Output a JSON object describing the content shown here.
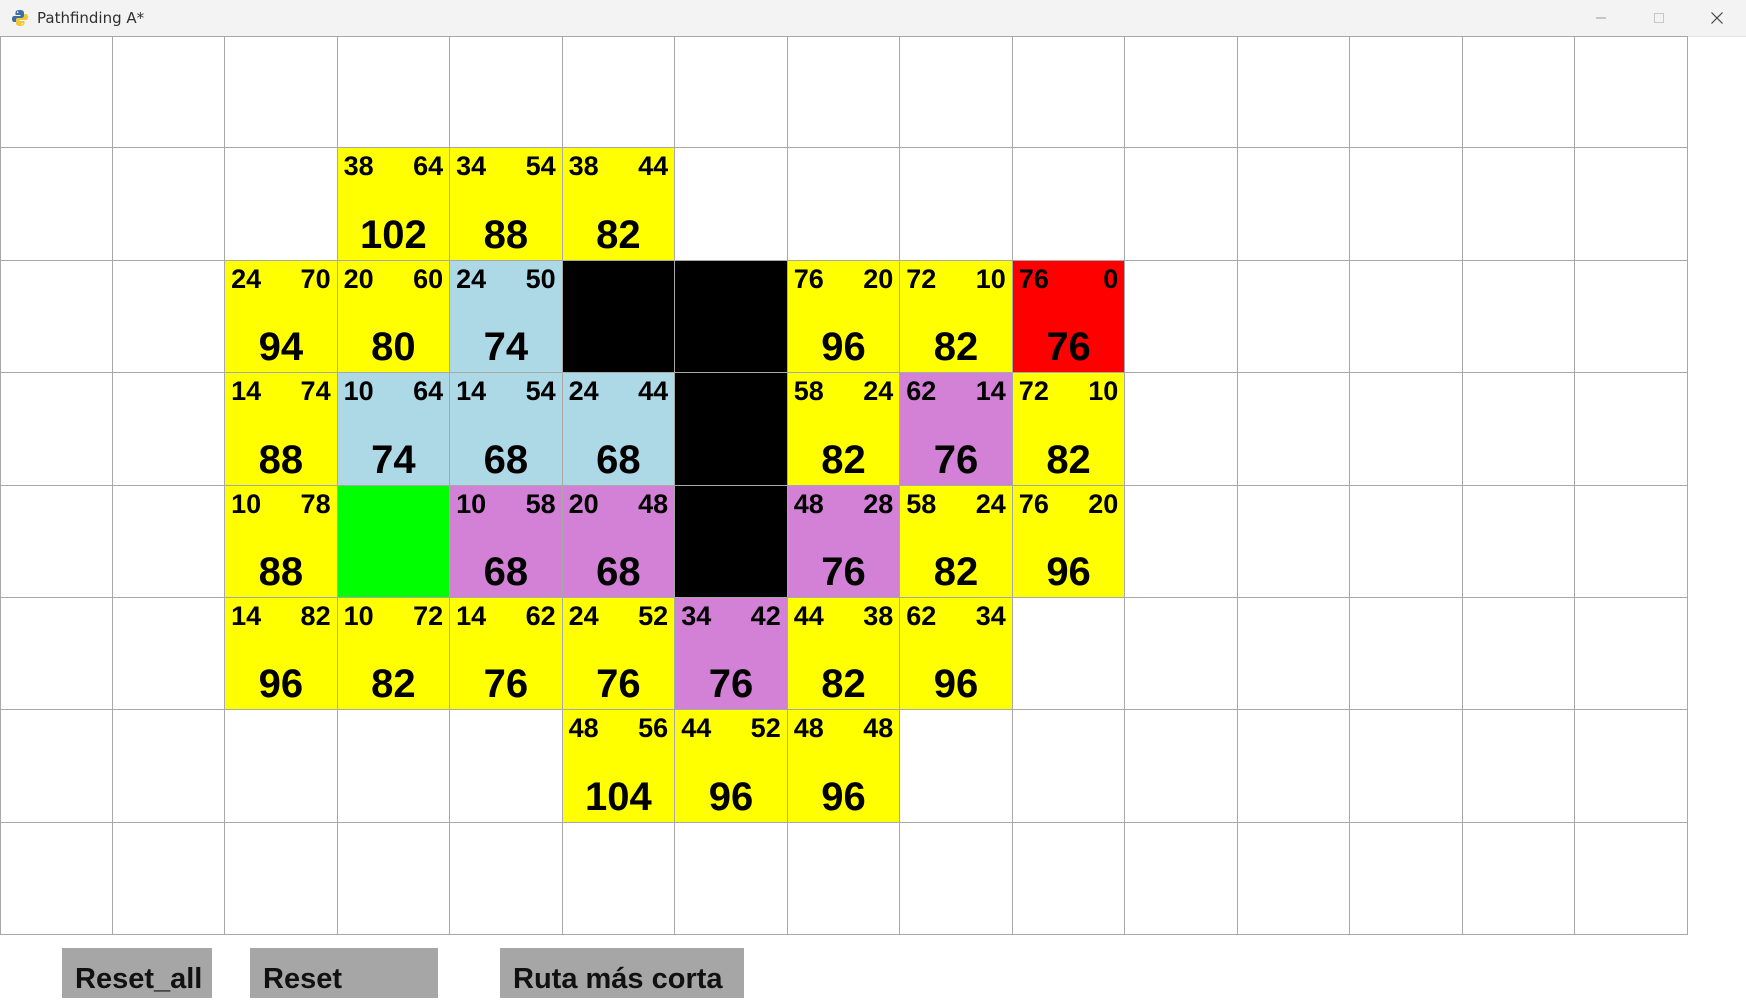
{
  "window": {
    "title": "Pathfinding A*",
    "icon": "python-icon",
    "controls": [
      "minimize-icon",
      "maximize-icon",
      "close-icon"
    ]
  },
  "grid": {
    "cols": 15,
    "rows": 8,
    "colors": {
      "empty": "#ffffff",
      "open": "#ffff00",
      "closed": "#add8e6",
      "path": "#d381d6",
      "barrier": "#000000",
      "start": "#00ff00",
      "end": "#ff0000"
    },
    "cells": [
      {
        "row": 1,
        "col": 3,
        "state": "open",
        "g": "38",
        "h": "64",
        "f": "102"
      },
      {
        "row": 1,
        "col": 4,
        "state": "open",
        "g": "34",
        "h": "54",
        "f": "88"
      },
      {
        "row": 1,
        "col": 5,
        "state": "open",
        "g": "38",
        "h": "44",
        "f": "82"
      },
      {
        "row": 2,
        "col": 2,
        "state": "open",
        "g": "24",
        "h": "70",
        "f": "94"
      },
      {
        "row": 2,
        "col": 3,
        "state": "open",
        "g": "20",
        "h": "60",
        "f": "80"
      },
      {
        "row": 2,
        "col": 4,
        "state": "closed",
        "g": "24",
        "h": "50",
        "f": "74"
      },
      {
        "row": 2,
        "col": 5,
        "state": "barrier"
      },
      {
        "row": 2,
        "col": 6,
        "state": "barrier"
      },
      {
        "row": 2,
        "col": 7,
        "state": "open",
        "g": "76",
        "h": "20",
        "f": "96"
      },
      {
        "row": 2,
        "col": 8,
        "state": "open",
        "g": "72",
        "h": "10",
        "f": "82"
      },
      {
        "row": 2,
        "col": 9,
        "state": "end",
        "g": "76",
        "h": "0",
        "f": "76"
      },
      {
        "row": 3,
        "col": 2,
        "state": "open",
        "g": "14",
        "h": "74",
        "f": "88"
      },
      {
        "row": 3,
        "col": 3,
        "state": "closed",
        "g": "10",
        "h": "64",
        "f": "74"
      },
      {
        "row": 3,
        "col": 4,
        "state": "closed",
        "g": "14",
        "h": "54",
        "f": "68"
      },
      {
        "row": 3,
        "col": 5,
        "state": "closed",
        "g": "24",
        "h": "44",
        "f": "68"
      },
      {
        "row": 3,
        "col": 6,
        "state": "barrier"
      },
      {
        "row": 3,
        "col": 7,
        "state": "open",
        "g": "58",
        "h": "24",
        "f": "82"
      },
      {
        "row": 3,
        "col": 8,
        "state": "path",
        "g": "62",
        "h": "14",
        "f": "76"
      },
      {
        "row": 3,
        "col": 9,
        "state": "open",
        "g": "72",
        "h": "10",
        "f": "82"
      },
      {
        "row": 4,
        "col": 2,
        "state": "open",
        "g": "10",
        "h": "78",
        "f": "88"
      },
      {
        "row": 4,
        "col": 3,
        "state": "start"
      },
      {
        "row": 4,
        "col": 4,
        "state": "path",
        "g": "10",
        "h": "58",
        "f": "68"
      },
      {
        "row": 4,
        "col": 5,
        "state": "path",
        "g": "20",
        "h": "48",
        "f": "68"
      },
      {
        "row": 4,
        "col": 6,
        "state": "barrier"
      },
      {
        "row": 4,
        "col": 7,
        "state": "path",
        "g": "48",
        "h": "28",
        "f": "76"
      },
      {
        "row": 4,
        "col": 8,
        "state": "open",
        "g": "58",
        "h": "24",
        "f": "82"
      },
      {
        "row": 4,
        "col": 9,
        "state": "open",
        "g": "76",
        "h": "20",
        "f": "96"
      },
      {
        "row": 5,
        "col": 2,
        "state": "open",
        "g": "14",
        "h": "82",
        "f": "96"
      },
      {
        "row": 5,
        "col": 3,
        "state": "open",
        "g": "10",
        "h": "72",
        "f": "82"
      },
      {
        "row": 5,
        "col": 4,
        "state": "open",
        "g": "14",
        "h": "62",
        "f": "76"
      },
      {
        "row": 5,
        "col": 5,
        "state": "open",
        "g": "24",
        "h": "52",
        "f": "76"
      },
      {
        "row": 5,
        "col": 6,
        "state": "path",
        "g": "34",
        "h": "42",
        "f": "76"
      },
      {
        "row": 5,
        "col": 7,
        "state": "open",
        "g": "44",
        "h": "38",
        "f": "82"
      },
      {
        "row": 5,
        "col": 8,
        "state": "open",
        "g": "62",
        "h": "34",
        "f": "96"
      },
      {
        "row": 6,
        "col": 5,
        "state": "open",
        "g": "48",
        "h": "56",
        "f": "104"
      },
      {
        "row": 6,
        "col": 6,
        "state": "open",
        "g": "44",
        "h": "52",
        "f": "96"
      },
      {
        "row": 6,
        "col": 7,
        "state": "open",
        "g": "48",
        "h": "48",
        "f": "96"
      }
    ]
  },
  "buttons": {
    "reset_all": "Reset_all",
    "reset": "Reset",
    "shortest_path": "Ruta más corta"
  }
}
